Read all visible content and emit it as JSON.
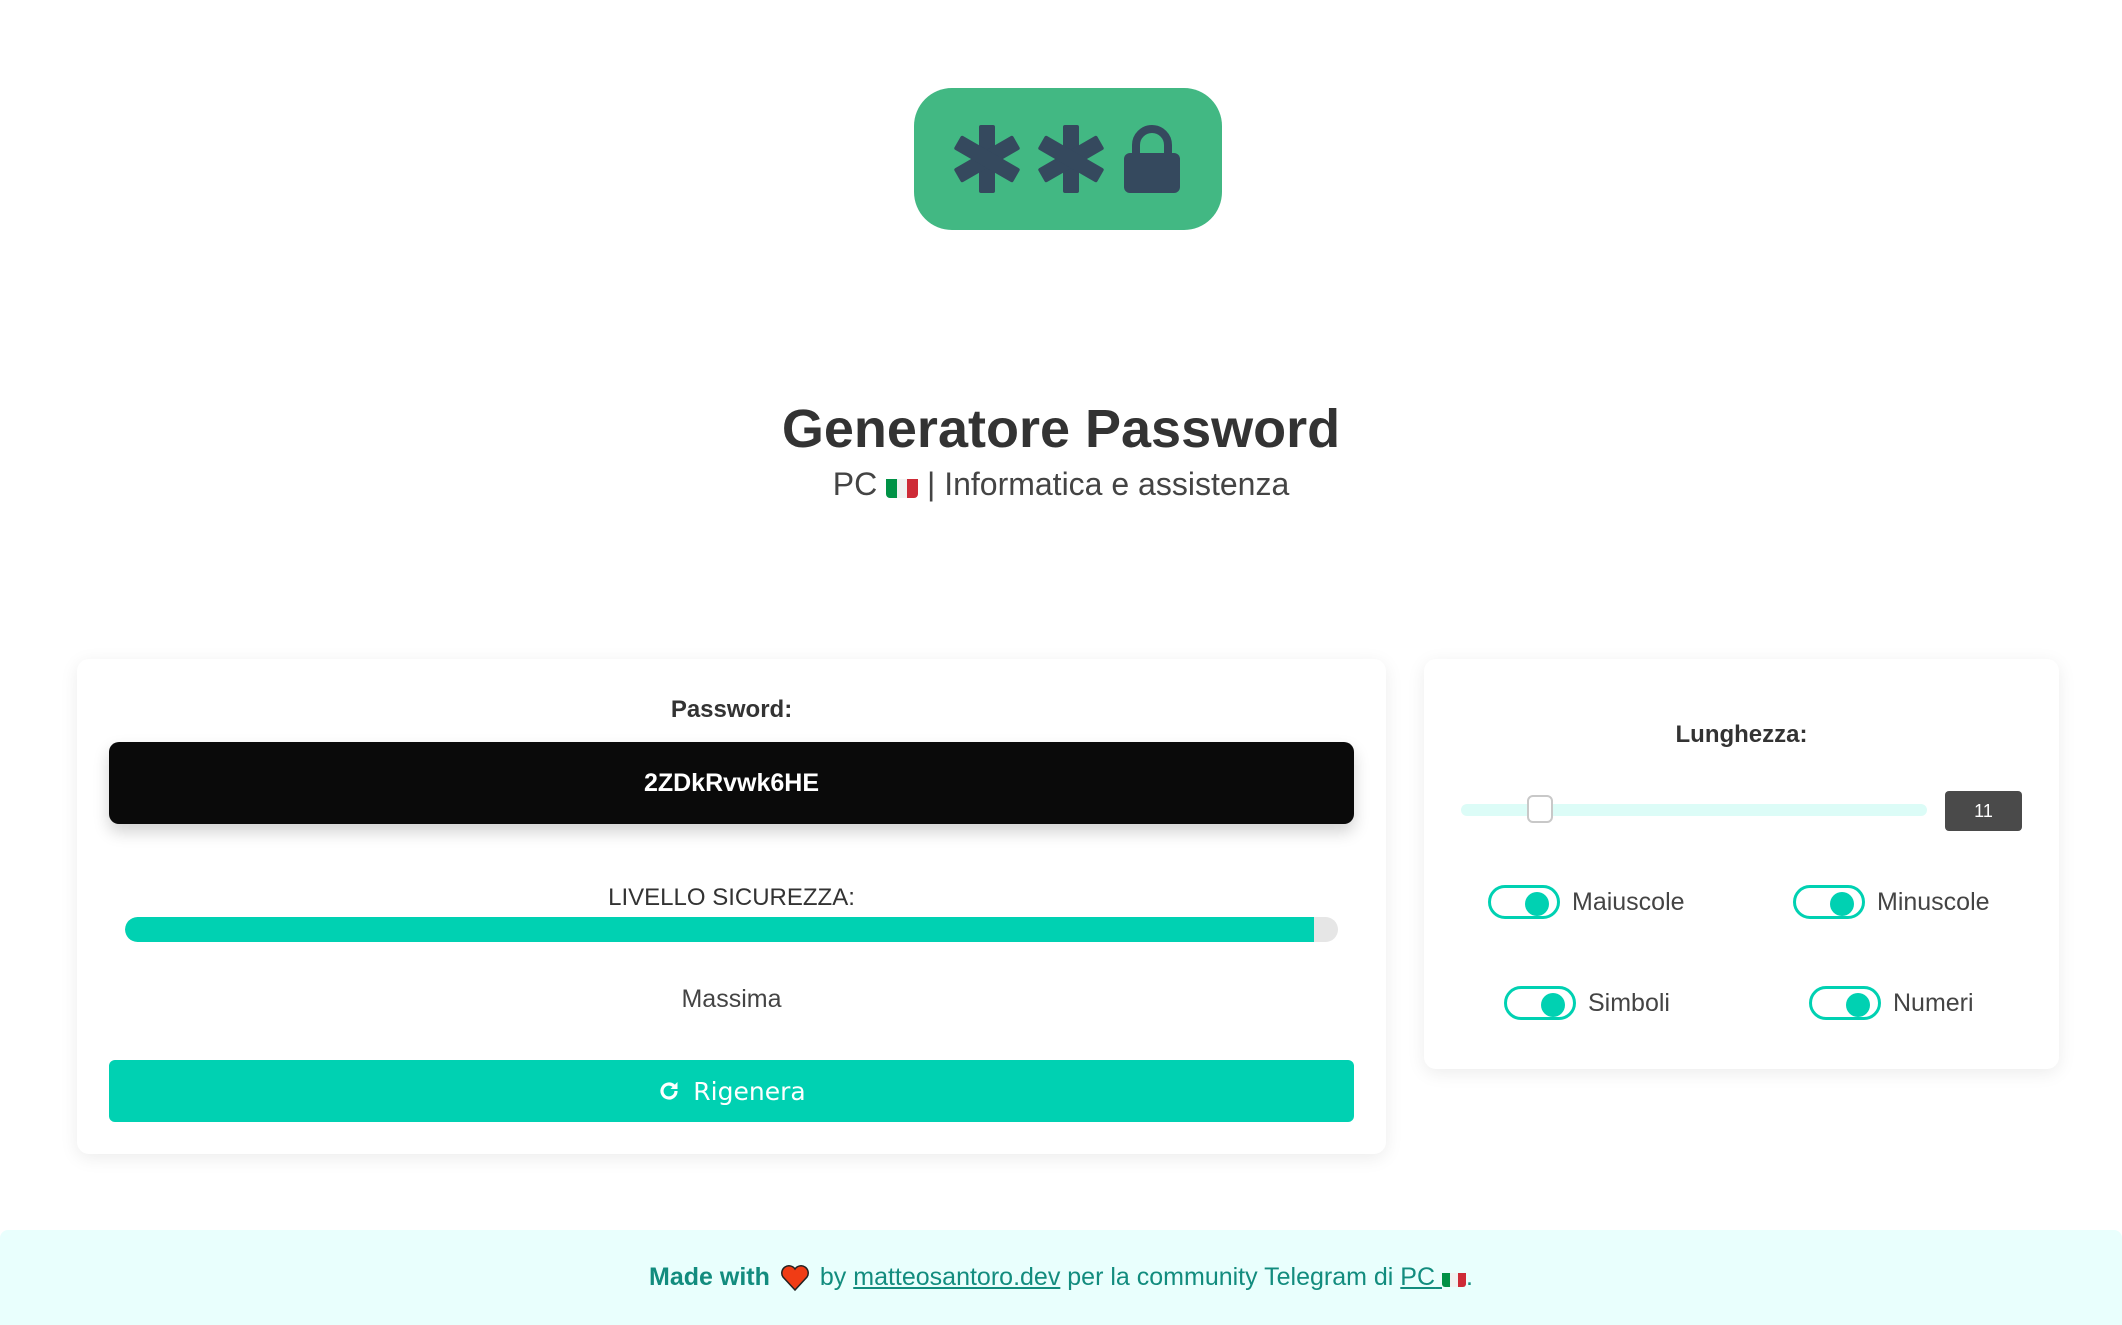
{
  "header": {
    "logo_icon": "password-asterisks-lock-icon",
    "title": "Generatore Password",
    "subtitle_prefix": "PC",
    "subtitle_flag": "italy-flag-icon",
    "subtitle_suffix": "| Informatica e assistenza"
  },
  "password_card": {
    "label": "Password:",
    "value": "2ZDkRvwk6HE",
    "security_label": "LIVELLO SICUREZZA:",
    "security_percent": 98,
    "security_value": "Massima",
    "regenerate_icon": "refresh-icon",
    "regenerate_label": "Rigenera"
  },
  "options_card": {
    "length_label": "Lunghezza:",
    "length_value": "11",
    "length_fraction": 0.12,
    "toggles": [
      {
        "label": "Maiuscole",
        "checked": true
      },
      {
        "label": "Minuscole",
        "checked": true
      },
      {
        "label": "Simboli",
        "checked": true
      },
      {
        "label": "Numeri",
        "checked": true
      }
    ]
  },
  "footer": {
    "made_with": "Made with",
    "heart_icon": "heart-icon",
    "by": "by",
    "author_link": "matteosantoro.dev",
    "middle_text": "per la community Telegram di",
    "community_link": "PC",
    "end": "."
  },
  "colors": {
    "accent": "#00d1b2",
    "logo_bg": "#42b883",
    "logo_fg": "#35495e",
    "footer_bg": "#e9fffd",
    "footer_text": "#128c7e"
  }
}
